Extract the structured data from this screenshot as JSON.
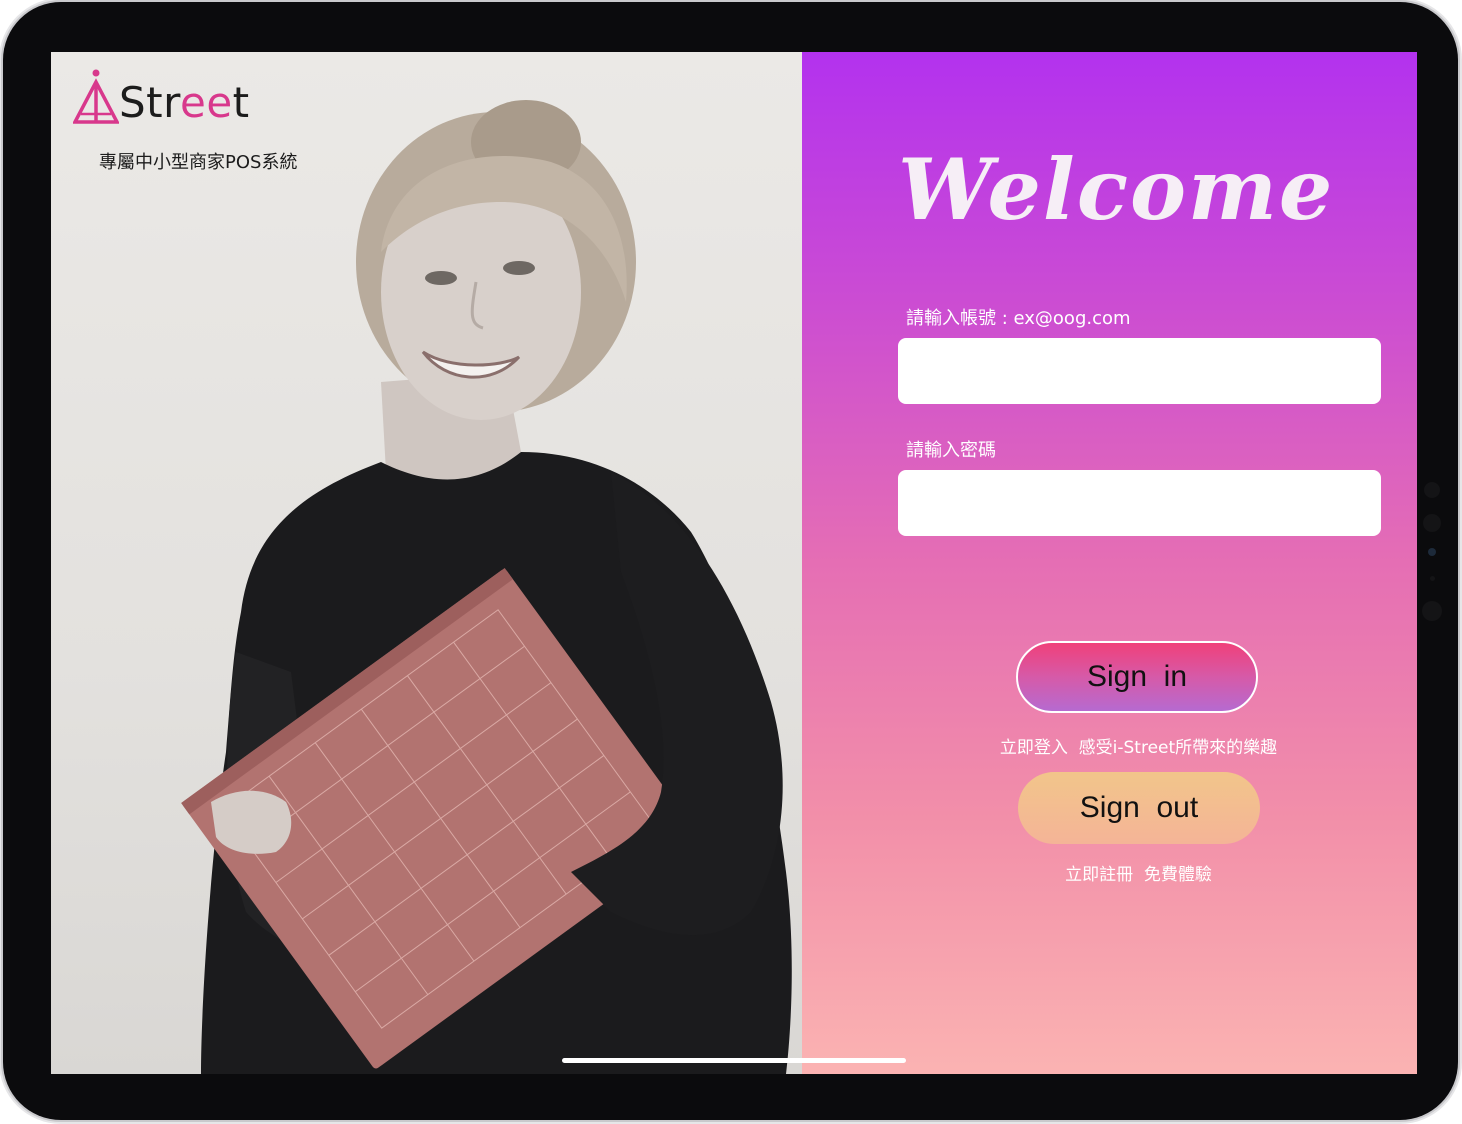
{
  "brand": {
    "logo_prefix": "Str",
    "logo_accent": "ee",
    "logo_suffix": "t",
    "tagline": "專屬中小型商家POS系統",
    "accent_color": "#d8388c"
  },
  "login": {
    "heading": "Welcome",
    "account_label": "請輸入帳號 : ex@oog.com",
    "account_value": "",
    "password_label": "請輸入密碼",
    "password_value": "",
    "sign_in_label": "Sign  in",
    "sign_in_hint": "立即登入  感受i-Street所帶來的樂趣",
    "sign_out_label": "Sign  out",
    "sign_out_hint": "立即註冊  免費體驗"
  },
  "icons": {
    "logo_mark": "i-street-logo-icon"
  },
  "colors": {
    "gradient_top": "#b332ee",
    "gradient_bottom": "#fbb3b2",
    "sign_in_button": "#f0407a",
    "sign_out_button": "#f2c58a"
  }
}
